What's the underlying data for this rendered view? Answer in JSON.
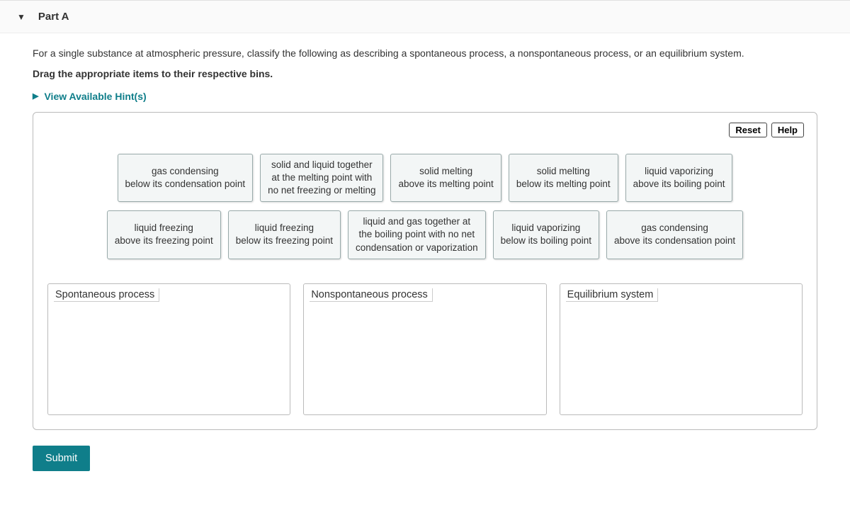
{
  "part": {
    "label": "Part A"
  },
  "prompt": {
    "text": "For a single substance at atmospheric pressure, classify the following as describing a spontaneous process, a  nonspontaneous process, or an equilibrium system.",
    "instruction": "Drag the appropriate items to their respective bins."
  },
  "hints": {
    "label": "View Available Hint(s)"
  },
  "controls": {
    "reset": "Reset",
    "help": "Help"
  },
  "items_row1": [
    "gas condensing\nbelow its condensation point",
    "solid and liquid together\nat the melting point with\nno net freezing or melting",
    "solid melting\nabove its melting point",
    "solid melting\nbelow its melting point",
    "liquid vaporizing\nabove its boiling point"
  ],
  "items_row2": [
    "liquid freezing\nabove its freezing point",
    "liquid freezing\nbelow its freezing point",
    "liquid and gas together at\nthe boiling point with no net\ncondensation or vaporization",
    "liquid vaporizing\nbelow its boiling point",
    "gas condensing\nabove its condensation point"
  ],
  "bins": {
    "spontaneous": "Spontaneous process",
    "nonspontaneous": "Nonspontaneous process",
    "equilibrium": "Equilibrium system"
  },
  "submit": {
    "label": "Submit"
  }
}
